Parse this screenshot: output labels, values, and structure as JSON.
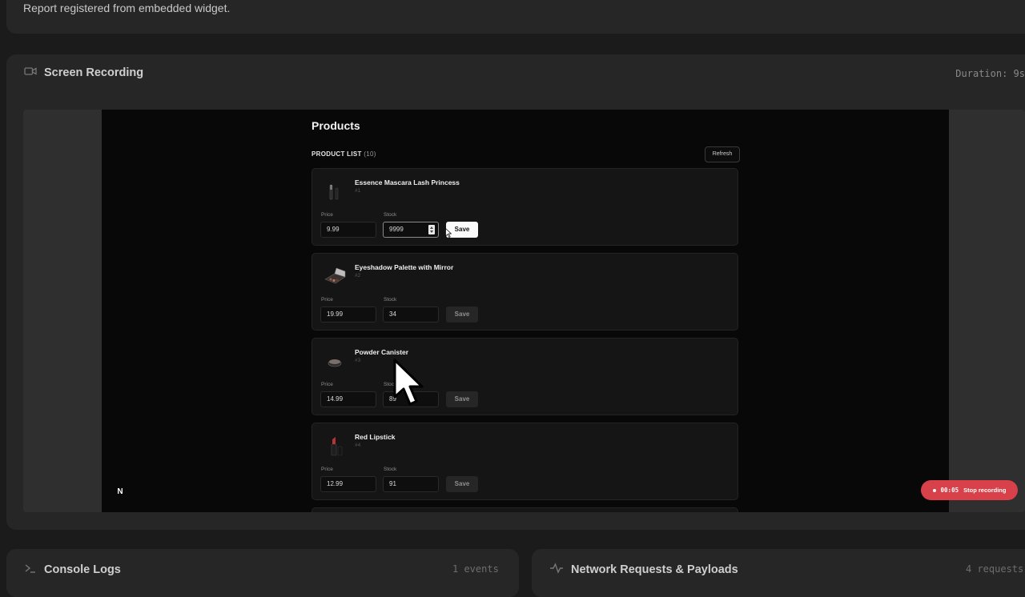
{
  "report": {
    "message": "Report registered from embedded widget."
  },
  "recording": {
    "title": "Screen Recording",
    "duration": "Duration: 9s",
    "page": {
      "title": "Products",
      "list_label": "PRODUCT LIST",
      "list_count": "(10)",
      "refresh_label": "Refresh",
      "products": [
        {
          "name": "Essence Mascara Lash Princess",
          "id": "#1",
          "price_label": "Price",
          "stock_label": "Stock",
          "price": "9.99",
          "stock": "9999",
          "save": "Save"
        },
        {
          "name": "Eyeshadow Palette with Mirror",
          "id": "#2",
          "price_label": "Price",
          "stock_label": "Stock",
          "price": "19.99",
          "stock": "34",
          "save": "Save"
        },
        {
          "name": "Powder Canister",
          "id": "#3",
          "price_label": "Price",
          "stock_label": "Stock",
          "price": "14.99",
          "stock": "89",
          "save": "Save"
        },
        {
          "name": "Red Lipstick",
          "id": "#4",
          "price_label": "Price",
          "stock_label": "Stock",
          "price": "12.99",
          "stock": "91",
          "save": "Save"
        }
      ]
    },
    "stop_button": {
      "time": "00:05",
      "label": "Stop recording"
    },
    "logo_letter": "N"
  },
  "console": {
    "title": "Console Logs",
    "events": "1 events"
  },
  "network": {
    "title": "Network Requests & Payloads",
    "requests": "4 requests"
  },
  "icons": {
    "camera": "video-camera-icon",
    "terminal": "terminal-icon",
    "activity": "activity-icon",
    "pointer": "mouse-pointer-icon"
  }
}
